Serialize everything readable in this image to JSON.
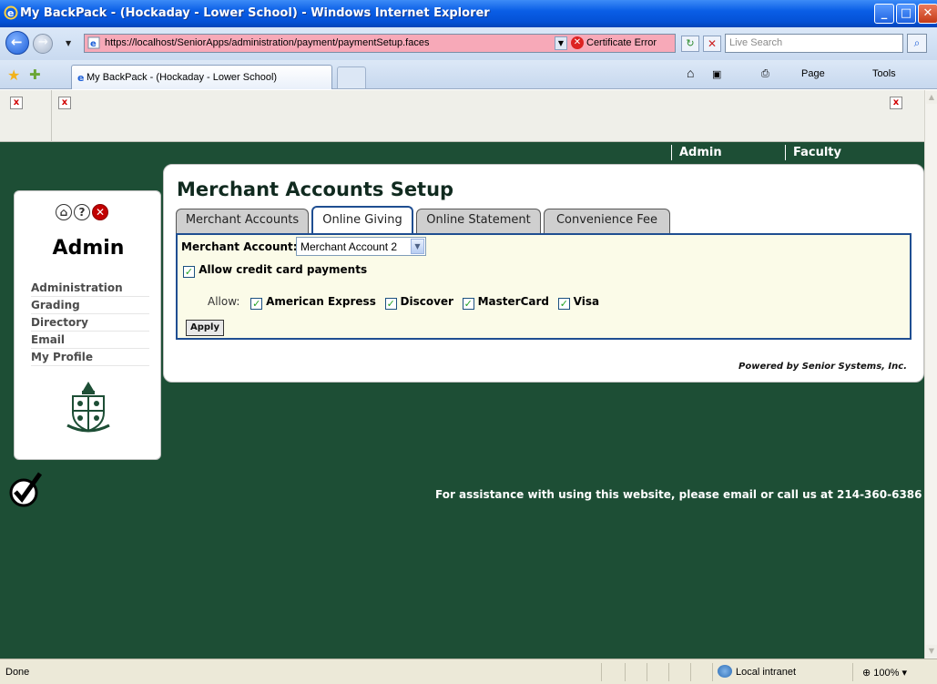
{
  "window": {
    "title": "My BackPack - (Hockaday - Lower School) - Windows Internet Explorer",
    "minimize": "_",
    "maximize": "□",
    "close": "✕"
  },
  "address": {
    "url": "https://localhost/SeniorApps/administration/payment/paymentSetup.faces",
    "certificate": "Certificate Error",
    "search_placeholder": "Live Search"
  },
  "browser_tab": {
    "label": "My BackPack - (Hockaday - Lower School)"
  },
  "command_bar": {
    "page": "Page",
    "tools": "Tools"
  },
  "top_nav": [
    "Admin",
    "Faculty"
  ],
  "left_panel": {
    "title": "Admin",
    "menu": [
      "Administration",
      "Grading",
      "Directory",
      "Email",
      "My Profile"
    ]
  },
  "main": {
    "title": "Merchant Accounts Setup",
    "tabs": [
      "Merchant Accounts",
      "Online Giving",
      "Online Statement",
      "Convenience Fee"
    ],
    "active_tab": "Online Giving",
    "merchant_label": "Merchant Account:",
    "merchant_value": "Merchant Account 2",
    "allow_cc_label": "Allow credit card payments",
    "allow_label": "Allow:",
    "cards": [
      "American Express",
      "Discover",
      "MasterCard",
      "Visa"
    ],
    "apply": "Apply",
    "powered_by": "Powered by Senior Systems, Inc."
  },
  "footer": {
    "assist": "For assistance with using this website, please email or call us at 214-360-6386"
  },
  "status": {
    "left": "Done",
    "zone": "Local intranet",
    "zoom": "100%"
  }
}
